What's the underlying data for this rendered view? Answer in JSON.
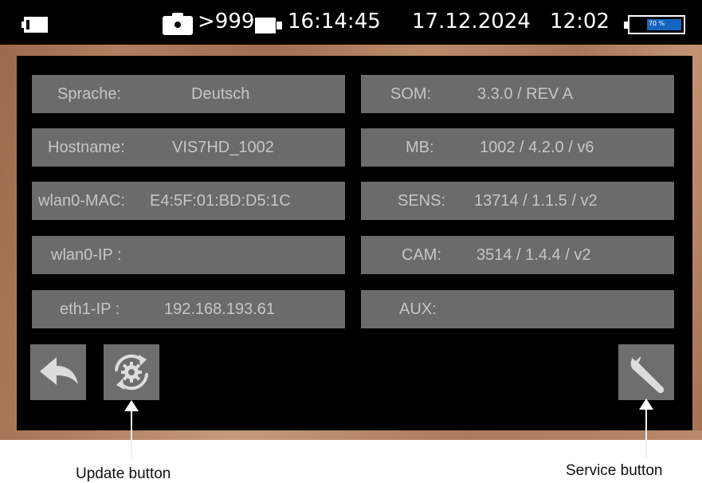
{
  "status_bar": {
    "photo_count": ">999",
    "clock": "16:14:45",
    "date": "17.12.2024",
    "time": "12:02",
    "battery": {
      "label": "70 %",
      "level_percent": 70,
      "fill_color": "#1565c0"
    }
  },
  "info_panel": {
    "left_fields": [
      {
        "label": "Sprache:",
        "value": "Deutsch"
      },
      {
        "label": "Hostname:",
        "value": "VIS7HD_1002"
      },
      {
        "label": "wlan0-MAC:",
        "value": "E4:5F:01:BD:D5:1C"
      },
      {
        "label": "wlan0-IP :",
        "value": ""
      },
      {
        "label": "eth1-IP :",
        "value": "192.168.193.61"
      }
    ],
    "right_fields": [
      {
        "label": "SOM:",
        "value": "3.3.0 / REV A"
      },
      {
        "label": "MB:",
        "value": "1002 / 4.2.0 / v6"
      },
      {
        "label": "SENS:",
        "value": "13714 / 1.1.5 / v2"
      },
      {
        "label": "CAM:",
        "value": "3514 / 1.4.4 / v2"
      },
      {
        "label": "AUX:",
        "value": ""
      }
    ]
  },
  "buttons": {
    "back": {
      "icon": "back-arrow-icon"
    },
    "update": {
      "icon": "refresh-gear-icon"
    },
    "service": {
      "icon": "wrench-icon"
    }
  },
  "annotations": {
    "update_caption": "Update button",
    "service_caption": "Service button"
  },
  "colors": {
    "field_bg": "#6b6b6b",
    "field_text": "#c6c6c6",
    "panel_bg": "#000000",
    "button_bg": "#6e6e6e"
  }
}
